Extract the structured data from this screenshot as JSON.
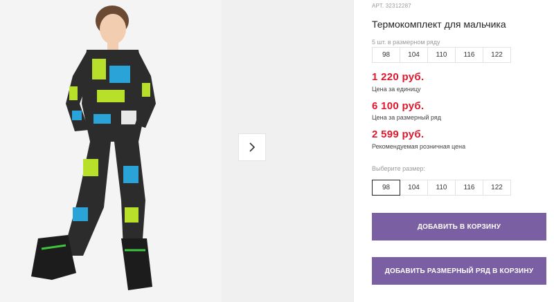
{
  "gallery": {
    "main_photo_icon": "product-photo-boy-thermal-set",
    "next_icon": "chevron-right-icon"
  },
  "product": {
    "article": "АРТ. 32312287",
    "title": "Термокомплект для мальчика",
    "set_note": "5 шт. в размерном ряду",
    "set_sizes": [
      "98",
      "104",
      "110",
      "116",
      "122"
    ]
  },
  "prices": {
    "unit_price": "1 220 руб.",
    "unit_label": "Цена за единицу",
    "set_price": "6 100 руб.",
    "set_label": "Цена за размерный ряд",
    "retail_price": "2 599 руб.",
    "retail_label": "Рекомендуемая розничная цена"
  },
  "size_selector": {
    "label": "Выберите размер:",
    "options": [
      "98",
      "104",
      "110",
      "116",
      "122"
    ],
    "selected": "98"
  },
  "actions": {
    "add_to_cart": "ДОБАВИТЬ В КОРЗИНУ",
    "add_set_to_cart": "ДОБАВИТЬ РАЗМЕРНЫЙ РЯД В КОРЗИНУ"
  },
  "colors": {
    "price": "#e0162b",
    "button": "#7b5fa3"
  }
}
